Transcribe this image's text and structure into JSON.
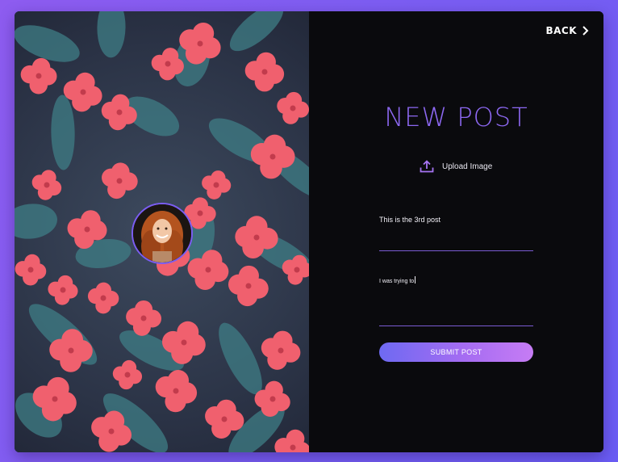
{
  "nav": {
    "back_label": "BACK"
  },
  "form": {
    "heading": "NEW POST",
    "upload_label": "Upload Image",
    "title_value": "This is the 3rd post",
    "body_value": "I was trying to",
    "submit_label": "SUBMIT POST"
  },
  "colors": {
    "page_gradient_start": "#8e5cf0",
    "page_gradient_end": "#6a5cf4",
    "panel_bg": "#0a0a0d",
    "accent": "#8d68f2",
    "flower": "#f0606e",
    "leaf": "#3f7d86"
  },
  "icons": {
    "back": "chevron-right-icon",
    "upload": "upload-icon"
  }
}
